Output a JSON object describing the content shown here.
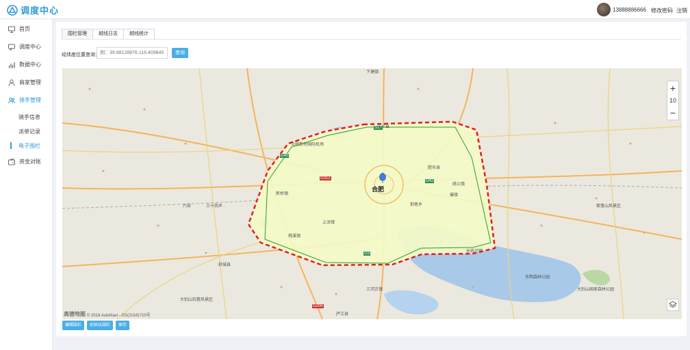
{
  "header": {
    "logo_text": "调度中心",
    "username": "13888886666",
    "change_password": "修改密码",
    "logout": "注销"
  },
  "sidebar": {
    "items": [
      {
        "label": "首页",
        "icon": "monitor-icon"
      },
      {
        "label": "调度中心",
        "icon": "chat-icon"
      },
      {
        "label": "数据中心",
        "icon": "bar-chart-icon"
      },
      {
        "label": "商家管理",
        "icon": "user-icon"
      },
      {
        "label": "骑手管理",
        "icon": "users-icon"
      },
      {
        "label": "资金对账",
        "icon": "wallet-icon"
      }
    ],
    "sub_items": [
      {
        "label": "骑手信息"
      },
      {
        "label": "派单记录"
      },
      {
        "label": "电子围栏"
      }
    ]
  },
  "tabs": [
    {
      "label": "围栏管理"
    },
    {
      "label": "越线日志"
    },
    {
      "label": "越线统计"
    }
  ],
  "search": {
    "label": "经纬度位置查询：",
    "placeholder": "例：39.88128876,116.40984535",
    "button": "查询"
  },
  "map": {
    "zoom_in": "+",
    "zoom_level": "10",
    "zoom_out": "−",
    "brand": "高德地图",
    "copyright": "© 2018 AutoNavi - GS(2016)710号",
    "city_label": "合肥",
    "place_labels": [
      "六安",
      "合肥新桥国际机场",
      "紫蓬山风景区",
      "大别山石窟风景区",
      "东陶森林公园",
      "大别山国家森林公园",
      "三河古镇",
      "长丰县",
      "肥东县",
      "新桥镇",
      "上派镇",
      "桃溪镇",
      "撮镇",
      "姚公镇",
      "荆巷乡",
      "长临河镇",
      "舒城县",
      "三十岗乡",
      "下塘镇",
      "庐江县"
    ],
    "road_labels": [
      "G312",
      "G3",
      "G40",
      "G42",
      "S17",
      "G206"
    ]
  },
  "actions": {
    "edit": "编辑围栏",
    "init": "初始化围栏",
    "save": "保存"
  },
  "colors": {
    "accent": "#2f9bdc",
    "button": "#4aaee8",
    "fence_red": "#e21d1d",
    "fence_green": "#2e9a2e",
    "fence_fill": "#f5fbc7"
  }
}
